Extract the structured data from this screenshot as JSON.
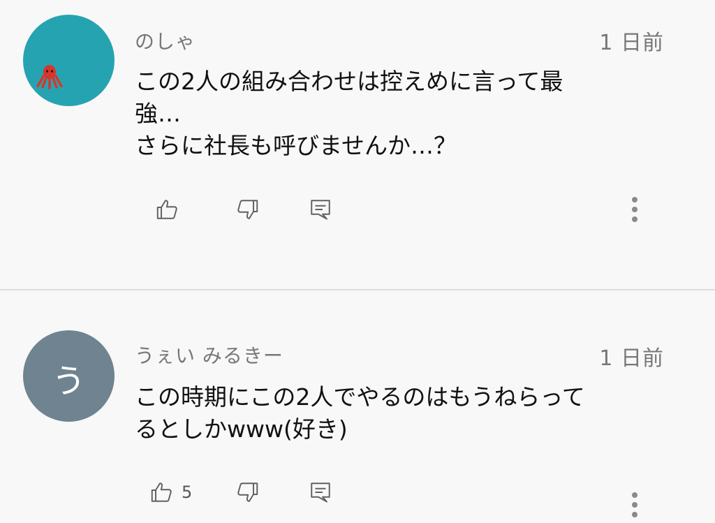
{
  "comments": [
    {
      "author": "のしゃ",
      "time": "1 日前",
      "text_lines": [
        "この2人の組み合わせは控えめに言って最",
        "強…",
        "さらに社長も呼びませんか…？"
      ],
      "avatar": {
        "type": "image",
        "icon": "octopus-icon",
        "bg_color": "#26a3b1",
        "icon_color": "#d9352b"
      },
      "likes": ""
    },
    {
      "author": "うぇい みるきー",
      "time": "1 日前",
      "text_lines": [
        "この時期にこの2人でやるのはもうねらって",
        "るとしかwww(好き)"
      ],
      "avatar": {
        "type": "letter",
        "letter": "う",
        "bg_color": "#6f8390"
      },
      "likes": "5"
    }
  ],
  "icons": {
    "like": "thumbs-up-icon",
    "dislike": "thumbs-down-icon",
    "reply": "reply-icon",
    "more": "more-vertical-icon"
  }
}
